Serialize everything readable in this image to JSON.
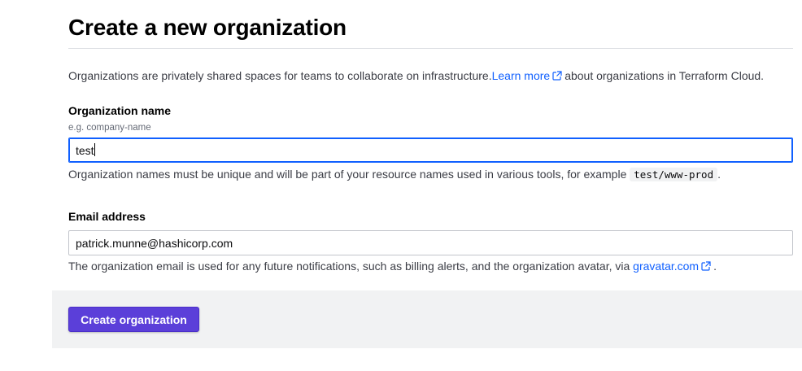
{
  "page": {
    "title": "Create a new organization"
  },
  "intro": {
    "text_before": "Organizations are privately shared spaces for teams to collaborate on infrastructure.",
    "link_label": "Learn more",
    "text_after": "about organizations in Terraform Cloud."
  },
  "org_name": {
    "label": "Organization name",
    "placeholder_hint": "e.g. company-name",
    "value": "test",
    "help_before": "Organization names must be unique and will be part of your resource names used in various tools, for example",
    "help_code": "test/www-prod",
    "help_after": "."
  },
  "email": {
    "label": "Email address",
    "value": "patrick.munne@hashicorp.com",
    "help_before": "The organization email is used for any future notifications, such as billing alerts, and the organization avatar, via",
    "help_link": "gravatar.com",
    "help_after": "."
  },
  "actions": {
    "create_label": "Create organization"
  },
  "colors": {
    "link": "#1060ff",
    "primary_button": "#5b3fd9",
    "focus_ring": "#1060ff",
    "footer_bg": "#f1f2f3"
  },
  "icons": {
    "external_link": "external-link-icon"
  }
}
